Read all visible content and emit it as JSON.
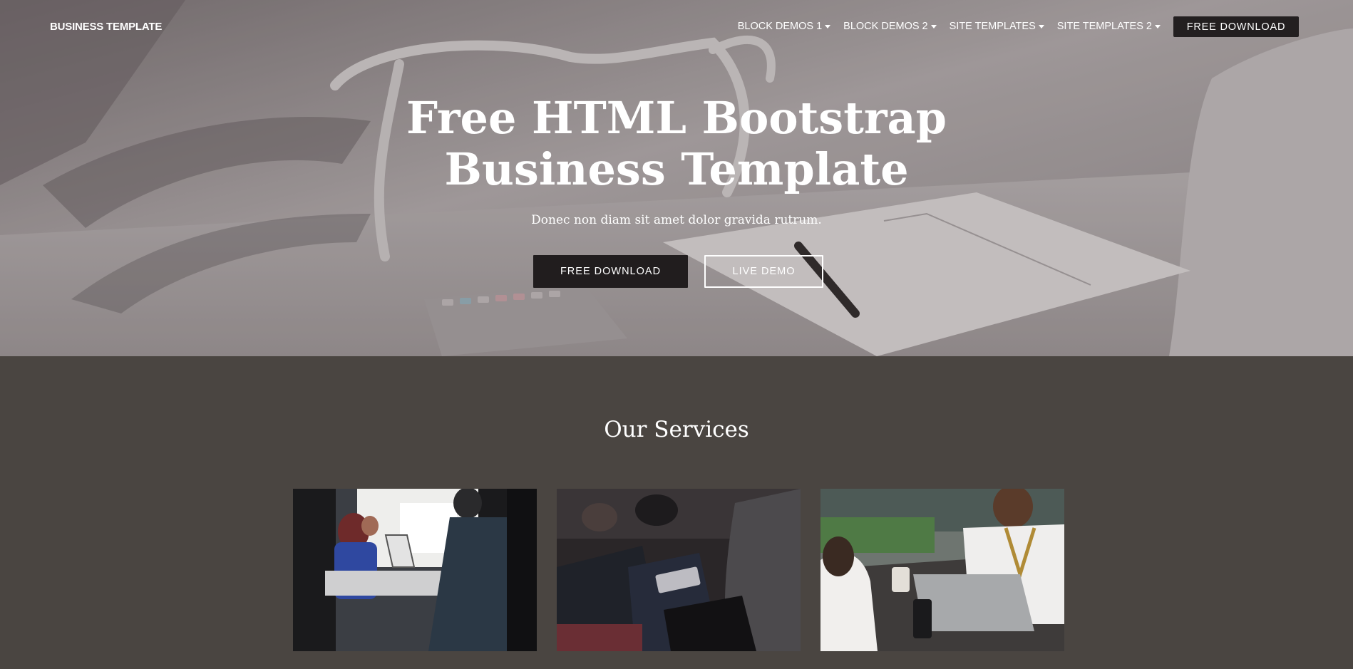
{
  "navbar": {
    "brand": "BUSINESS TEMPLATE",
    "items": [
      {
        "label": "BLOCK DEMOS 1"
      },
      {
        "label": "BLOCK DEMOS 2"
      },
      {
        "label": "SITE TEMPLATES"
      },
      {
        "label": "SITE TEMPLATES 2"
      }
    ],
    "cta_label": "FREE DOWNLOAD"
  },
  "hero": {
    "title_line1": "Free HTML Bootstrap",
    "title_line2": "Business Template",
    "subtitle": "Donec non diam sit amet dolor gravida rutrum.",
    "primary_button": "FREE DOWNLOAD",
    "secondary_button": "LIVE DEMO"
  },
  "services": {
    "title": "Our Services"
  },
  "colors": {
    "page_background": "#4a4541",
    "dark_button": "#211d1e",
    "text": "#ffffff"
  }
}
